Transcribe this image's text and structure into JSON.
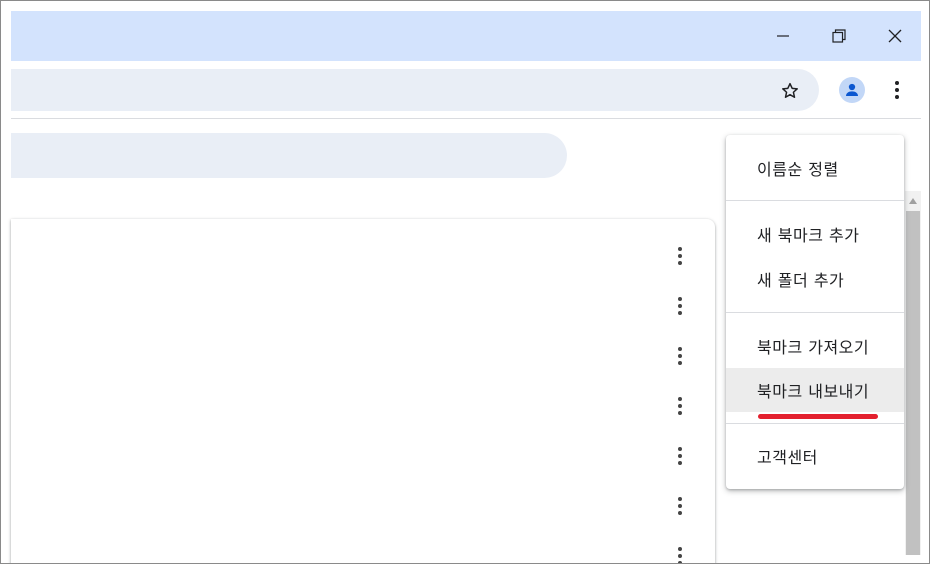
{
  "window": {
    "minimize_icon": "minimize-icon",
    "restore_icon": "restore-icon",
    "close_icon": "close-icon"
  },
  "toolbar": {
    "bookmark_star_icon": "star-icon",
    "profile_icon": "person-icon",
    "menu_icon": "more-vert-icon"
  },
  "menu": {
    "items": [
      {
        "label": "이름순 정렬"
      },
      {
        "label": "새 북마크 추가"
      },
      {
        "label": "새 폴더 추가"
      },
      {
        "label": "북마크 가져오기"
      },
      {
        "label": "북마크 내보내기"
      },
      {
        "label": "고객센터"
      }
    ],
    "highlighted_index": 4
  },
  "colors": {
    "titlebar": "#d3e3fd",
    "omnibox": "#e9eef6",
    "avatar_bg": "#c2d7f7",
    "avatar_fg": "#0b57d0",
    "highlight": "#e3202e"
  }
}
